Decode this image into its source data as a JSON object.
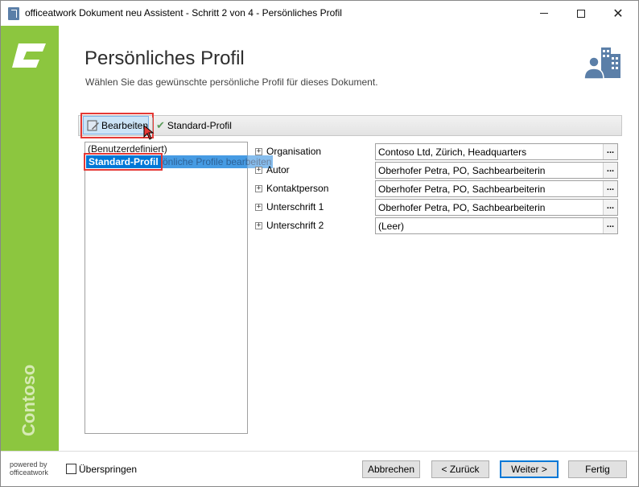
{
  "window": {
    "title": "officeatwork Dokument neu Assistent - Schritt 2 von 4 - Persönliches Profil"
  },
  "brand": {
    "vertical_text": "Contoso",
    "accent_color": "#8cc63f"
  },
  "header": {
    "title": "Persönliches Profil",
    "subtitle": "Wählen Sie das gewünschte persönliche Profil für dieses Dokument."
  },
  "toolbar": {
    "edit_label": "Bearbeiten",
    "standard_label": "Standard-Profil"
  },
  "profiles": {
    "items": [
      "(Benutzerdefiniert)",
      "Standard-Profil"
    ],
    "selected": "Standard-Profil",
    "tooltip": "önliche Profile bearbeiten"
  },
  "properties": [
    {
      "label": "Organisation",
      "value": "Contoso Ltd, Zürich, Headquarters",
      "button": "..."
    },
    {
      "label": "Autor",
      "value": "Oberhofer Petra, PO, Sachbearbeiterin",
      "button": "..."
    },
    {
      "label": "Kontaktperson",
      "value": "Oberhofer Petra, PO, Sachbearbeiterin",
      "button": "..."
    },
    {
      "label": "Unterschrift 1",
      "value": "Oberhofer Petra, PO, Sachbearbeiterin",
      "button": "..."
    },
    {
      "label": "Unterschrift 2",
      "value": "(Leer)",
      "button": "..."
    }
  ],
  "footer": {
    "powered_line1": "powered by",
    "powered_line2": "officeatwork",
    "skip_label": "Überspringen",
    "cancel_label": "Abbrechen",
    "back_label": "< Zurück",
    "next_label": "Weiter >",
    "finish_label": "Fertig"
  },
  "icons": {
    "app": "officeatwork-app-icon",
    "brand_logo": "contoso-c-logo-icon",
    "header": "person-building-icon",
    "edit": "edit-profile-icon",
    "standard": "checkmark-icon",
    "expand": "plus-box-icon"
  }
}
